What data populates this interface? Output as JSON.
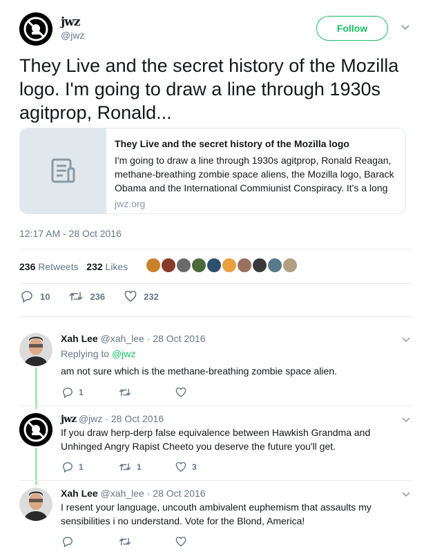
{
  "author": {
    "name": "jwz",
    "handle": "@jwz",
    "follow_label": "Follow"
  },
  "tweet": {
    "text": "They Live and the secret history of the Mozilla logo. I'm going to draw a line through 1930s agitprop, Ronald...",
    "card": {
      "title": "They Live and the secret history of the Mozilla logo",
      "description": "I'm going to draw a line through 1930s agitprop, Ronald Reagan, methane-breathing zombie space aliens, the Mozilla logo, Barack Obama and the International Commiunist Conspiracy. It's a long",
      "domain": "jwz.org"
    },
    "timestamp": "12:17 AM - 28 Oct 2016",
    "retweets_count": "236",
    "retweets_label": "Retweets",
    "likes_count": "232",
    "likes_label": "Likes",
    "replies_action": "10",
    "retweets_action": "236",
    "likes_action": "232"
  },
  "liker_colors": [
    "#c9812b",
    "#8a3a2a",
    "#6b6b6b",
    "#4a6a3a",
    "#2e4f6e",
    "#e8a040",
    "#9a7060",
    "#3a3a3a",
    "#5a7a8a",
    "#b0a080"
  ],
  "colors": {
    "accent_green": "#17bf63",
    "thread_line": "#a6e5b9",
    "muted": "#657786"
  },
  "replies": [
    {
      "name": "Xah Lee",
      "handle": "@xah_lee",
      "date": "· 28 Oct 2016",
      "replying_label": "Replying to",
      "replying_to": "@jwz",
      "text": "am not sure which is the methane-breathing zombie space alien.",
      "reply_count": "1",
      "retweet_count": "",
      "like_count": ""
    },
    {
      "name": "jwz",
      "handle": "@jwz",
      "date": "· 28 Oct 2016",
      "text": "If you draw herp-derp false equivalence between Hawkish Grandma and Unhinged Angry Rapist Cheeto you deserve the future you'll get.",
      "reply_count": "1",
      "retweet_count": "1",
      "like_count": "3"
    },
    {
      "name": "Xah Lee",
      "handle": "@xah_lee",
      "date": "· 28 Oct 2016",
      "text": "I resent your language, uncouth ambivalent euphemism that assaults my sensibilities i no understand. Vote for the Blond, America!",
      "reply_count": "",
      "retweet_count": "",
      "like_count": ""
    }
  ]
}
